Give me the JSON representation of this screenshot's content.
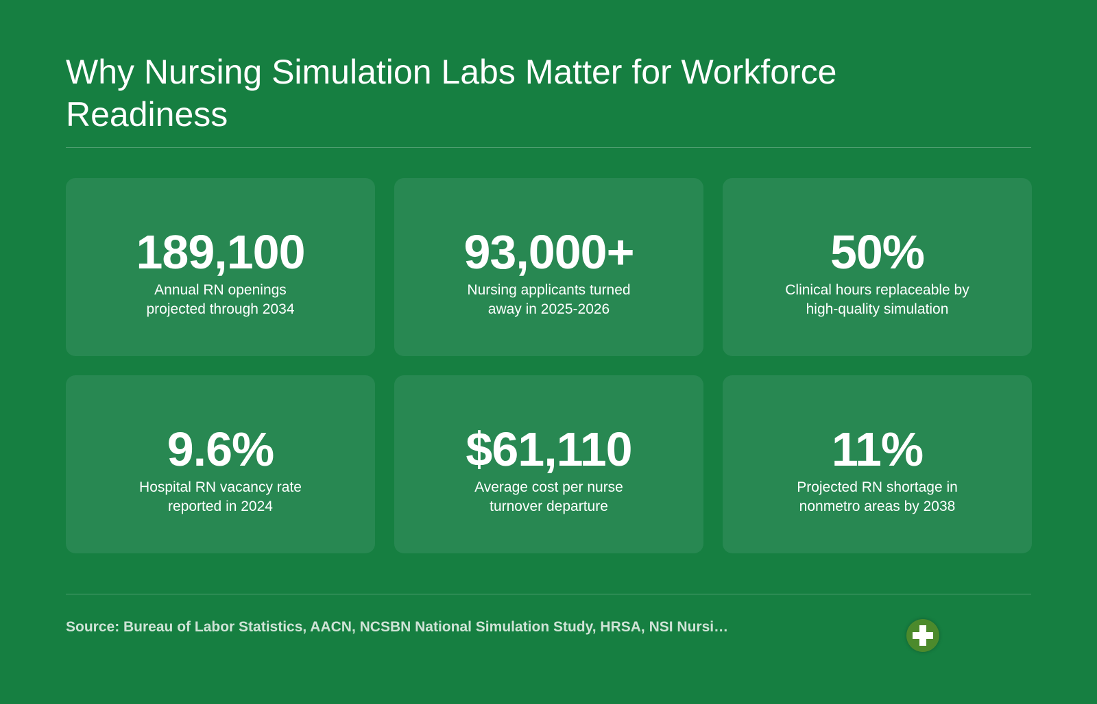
{
  "header": {
    "title": "Why Nursing Simulation Labs Matter for Workforce Readiness"
  },
  "stats": [
    {
      "value": "189,100",
      "label": "Annual RN openings projected through 2034"
    },
    {
      "value": "93,000+",
      "label": "Nursing applicants turned away in 2025-2026"
    },
    {
      "value": "50%",
      "label": "Clinical hours replaceable by high-quality simulation"
    },
    {
      "value": "9.6%",
      "label": "Hospital RN vacancy rate reported in 2024"
    },
    {
      "value": "$61,110",
      "label": "Average cost per nurse turnover departure"
    },
    {
      "value": "11%",
      "label": "Projected RN shortage in nonmetro areas by 2038"
    }
  ],
  "footer": {
    "source": "Source: Bureau of Labor Statistics, AACN, NCSBN National Simulation Study, HRSA, NSI Nursi…",
    "icon": "medical-cross-icon"
  },
  "colors": {
    "background": "#167f41",
    "card": "#288852",
    "badge": "#4c8a2c",
    "source_text": "#cfe3d6"
  }
}
